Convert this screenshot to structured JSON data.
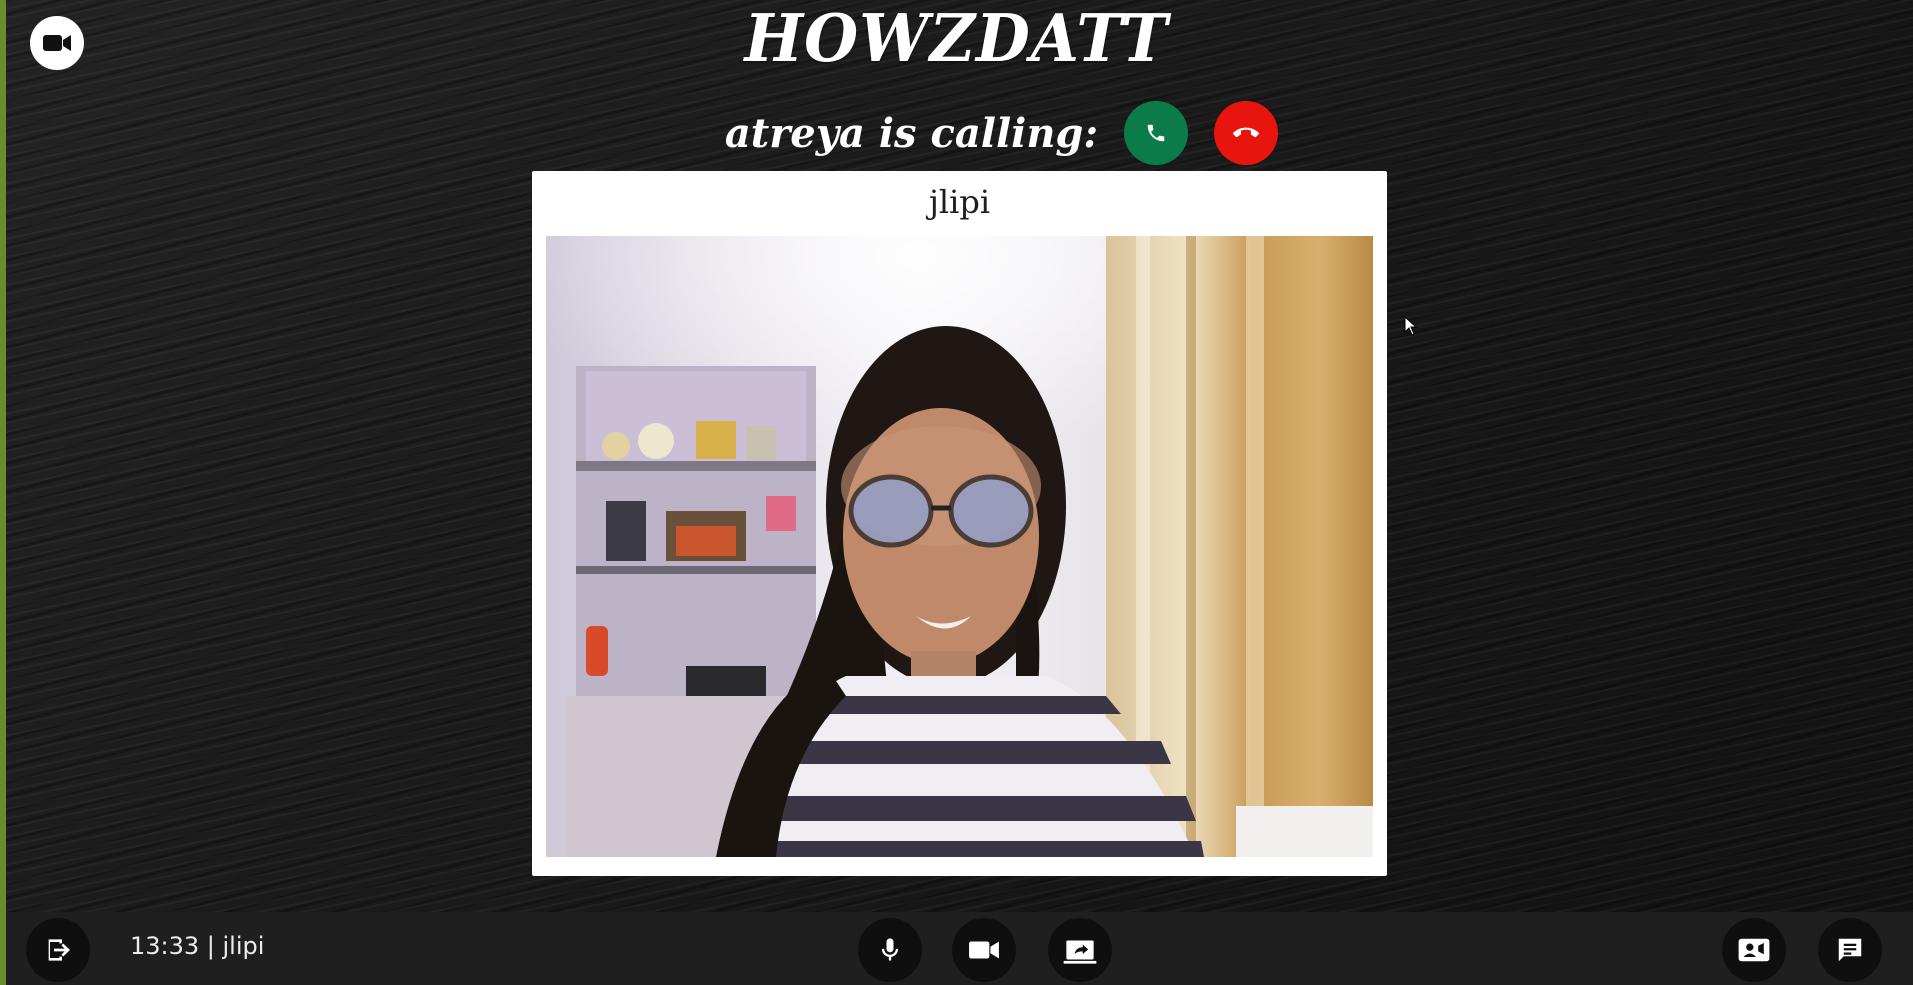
{
  "app": {
    "title": "HOWZDATT"
  },
  "incoming_call": {
    "text": "atreya is calling:",
    "accept_color": "#0c7b4a",
    "decline_color": "#e8150f"
  },
  "video_tile": {
    "participant_name": "jlipi"
  },
  "bottom_bar": {
    "status": "13:33 | jlipi"
  },
  "icons": {
    "logo": "video-camera-icon",
    "accept": "phone-icon",
    "decline": "phone-hangup-icon",
    "exit": "exit-icon",
    "mic": "microphone-icon",
    "camera": "video-camera-icon",
    "share": "screen-share-icon",
    "people": "contact-card-icon",
    "chat": "chat-icon"
  }
}
